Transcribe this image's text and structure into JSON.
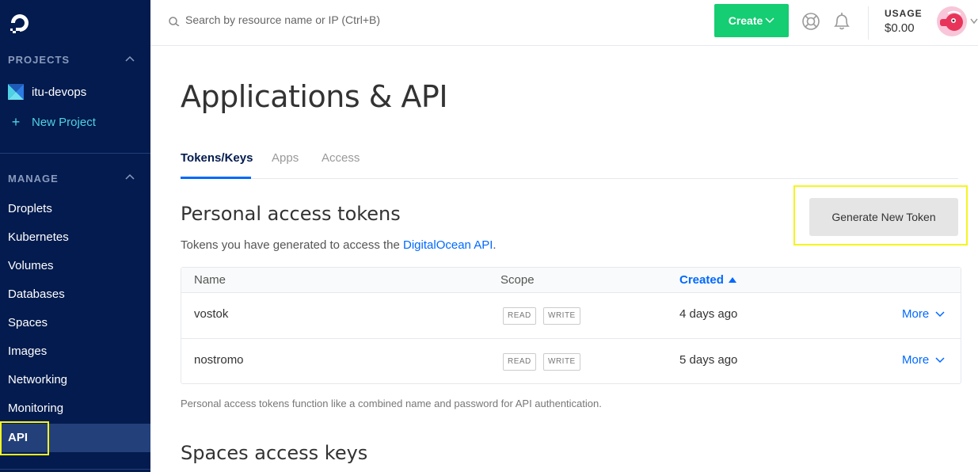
{
  "sidebar": {
    "projects_heading": "PROJECTS",
    "projects": [
      {
        "label": "itu-devops",
        "icon": "project-cube-icon"
      }
    ],
    "new_project_label": "New Project",
    "new_project_icon": "+",
    "manage_heading": "MANAGE",
    "nav": [
      {
        "label": "Droplets"
      },
      {
        "label": "Kubernetes"
      },
      {
        "label": "Volumes"
      },
      {
        "label": "Databases"
      },
      {
        "label": "Spaces"
      },
      {
        "label": "Images"
      },
      {
        "label": "Networking"
      },
      {
        "label": "Monitoring"
      },
      {
        "label": "API",
        "active": true
      }
    ]
  },
  "topbar": {
    "search_placeholder": "Search by resource name or IP (Ctrl+B)",
    "create_label": "Create",
    "usage_label": "USAGE",
    "usage_value": "$0.00"
  },
  "main": {
    "title": "Applications & API",
    "tabs": [
      {
        "label": "Tokens/Keys",
        "active": true
      },
      {
        "label": "Apps"
      },
      {
        "label": "Access"
      }
    ],
    "pat": {
      "title": "Personal access tokens",
      "desc_prefix": "Tokens you have generated to access the ",
      "desc_link": "DigitalOcean API",
      "desc_suffix": ".",
      "generate_label": "Generate New Token",
      "columns": {
        "name": "Name",
        "scope": "Scope",
        "created": "Created"
      },
      "rows": [
        {
          "name": "vostok",
          "scopes": [
            "READ",
            "WRITE"
          ],
          "created": "4 days ago",
          "more": "More"
        },
        {
          "name": "nostromo",
          "scopes": [
            "READ",
            "WRITE"
          ],
          "created": "5 days ago",
          "more": "More"
        }
      ],
      "note": "Personal access tokens function like a combined name and password for API authentication."
    },
    "spaces_title": "Spaces access keys"
  },
  "colors": {
    "sidebar_bg": "#031b4e",
    "accent": "#0069ff",
    "create_green": "#15cd72",
    "highlight": "#f5f520"
  }
}
